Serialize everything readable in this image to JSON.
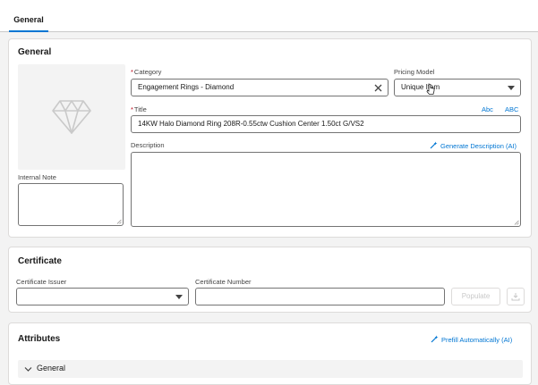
{
  "tabs": [
    {
      "label": "General"
    }
  ],
  "general": {
    "title": "General",
    "category": {
      "label": "Category",
      "value": "Engagement Rings - Diamond"
    },
    "pricing_model": {
      "label": "Pricing Model",
      "value": "Unique Item"
    },
    "title_field": {
      "label": "Title",
      "value": "14KW Halo Diamond Ring 208R-0.55ctw Cushion Center 1.50ct G/VS2",
      "case_lower": "Abc",
      "case_upper": "ABC"
    },
    "description": {
      "label": "Description",
      "ai_link": "Generate Description (AI)"
    },
    "internal_note": {
      "label": "Internal Note"
    }
  },
  "certificate": {
    "title": "Certificate",
    "issuer_label": "Certificate Issuer",
    "number_label": "Certificate Number",
    "populate_label": "Populate"
  },
  "attributes": {
    "title": "Attributes",
    "prefill_link": "Prefill Automatically (AI)",
    "section_label": "General"
  },
  "colors": {
    "accent": "#0176d3",
    "required": "#ba0517",
    "border": "#747474"
  }
}
